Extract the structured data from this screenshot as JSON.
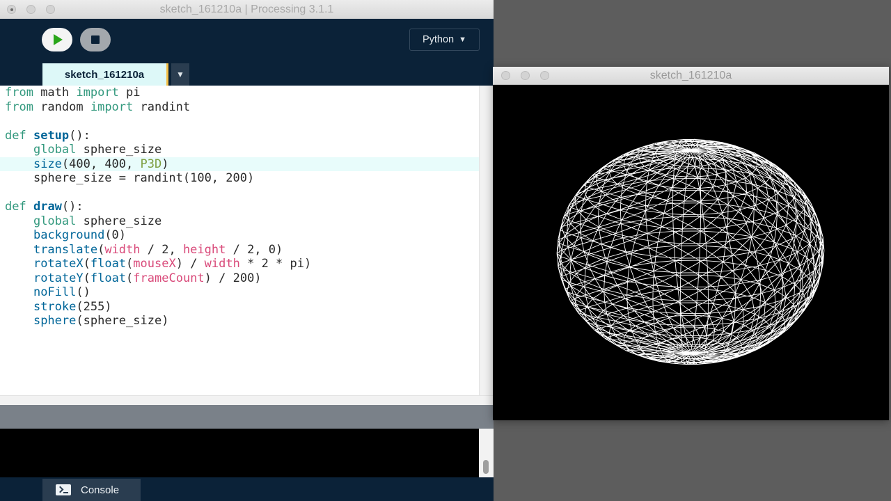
{
  "ide": {
    "window_title": "sketch_161210a | Processing 3.1.1",
    "mode_label": "Python",
    "mode_caret": "▼",
    "tab_label": "sketch_161210a",
    "tab_menu_glyph": "▼",
    "console_label": "Console",
    "code_lines": [
      "from math import pi",
      "from random import randint",
      "",
      "def setup():",
      "    global sphere_size",
      "    size(400, 400, P3D)",
      "    sphere_size = randint(100, 200)",
      "",
      "def draw():",
      "    global sphere_size",
      "    background(0)",
      "    translate(width / 2, height / 2, 0)",
      "    rotateX(float(mouseX) / width * 2 * pi)",
      "    rotateY(float(frameCount) / 200)",
      "    noFill()",
      "    stroke(255)",
      "    sphere(sphere_size)"
    ],
    "highlighted_line": 5
  },
  "sketch": {
    "window_title": "sketch_161210a",
    "background_color": "#000000",
    "stroke_color": "#ffffff"
  },
  "colors": {
    "run_icon": "#2aa61a",
    "toolbar_bg": "#0b2238",
    "tab_bg": "#ddf8f8",
    "tab_accent": "#f4bf45",
    "keyword": "#33997e",
    "function_name": "#006699",
    "constant": "#d94a7a",
    "literal": "#7d9e3f"
  },
  "icons": {
    "run": "play-icon",
    "stop": "stop-icon",
    "console": "terminal-icon"
  }
}
